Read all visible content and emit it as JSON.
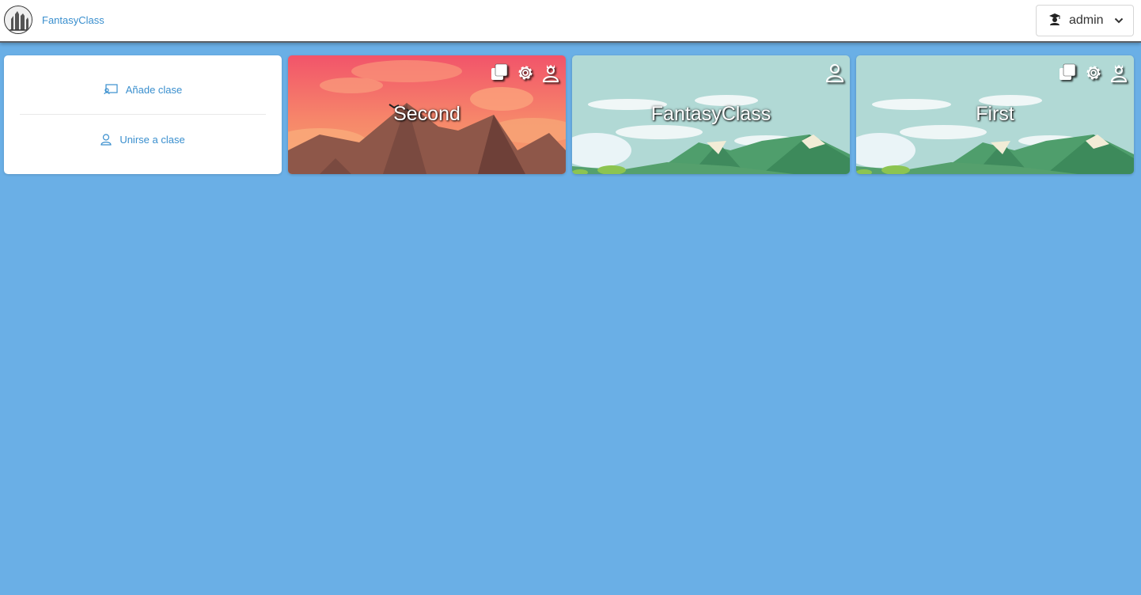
{
  "brand": {
    "name": "FantasyClass"
  },
  "user": {
    "name": "admin"
  },
  "actions": {
    "add_class": "Añade clase",
    "join_class": "Unirse a clase"
  },
  "classes": [
    {
      "title": "Second",
      "theme": "sunset",
      "icons": [
        "copy-icon",
        "gear-icon",
        "teacher-icon"
      ]
    },
    {
      "title": "FantasyClass",
      "theme": "mountains",
      "icons": [
        "user-icon"
      ]
    },
    {
      "title": "First",
      "theme": "mountains",
      "icons": [
        "copy-icon",
        "gear-icon",
        "teacher-icon"
      ]
    }
  ],
  "colors": {
    "background": "#6aafe6",
    "link": "#3a8fce"
  }
}
